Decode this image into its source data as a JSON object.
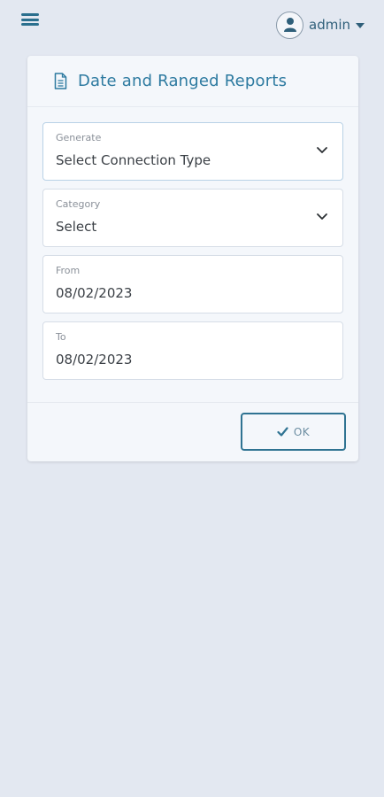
{
  "header": {
    "user_name": "admin"
  },
  "card": {
    "title": "Date and Ranged Reports"
  },
  "fields": {
    "generate": {
      "label": "Generate",
      "value": "Select Connection Type"
    },
    "category": {
      "label": "Category",
      "value": "Select"
    },
    "from": {
      "label": "From",
      "value": "08/02/2023"
    },
    "to": {
      "label": "To",
      "value": "08/02/2023"
    }
  },
  "footer": {
    "ok_label": "OK"
  },
  "colors": {
    "background": "#e3e8f1",
    "accent": "#2d7aa0",
    "button_border": "#2f7392"
  },
  "icons": [
    "menu-icon",
    "user-avatar-icon",
    "caret-down-icon",
    "document-icon",
    "chevron-down-icon",
    "check-icon"
  ]
}
